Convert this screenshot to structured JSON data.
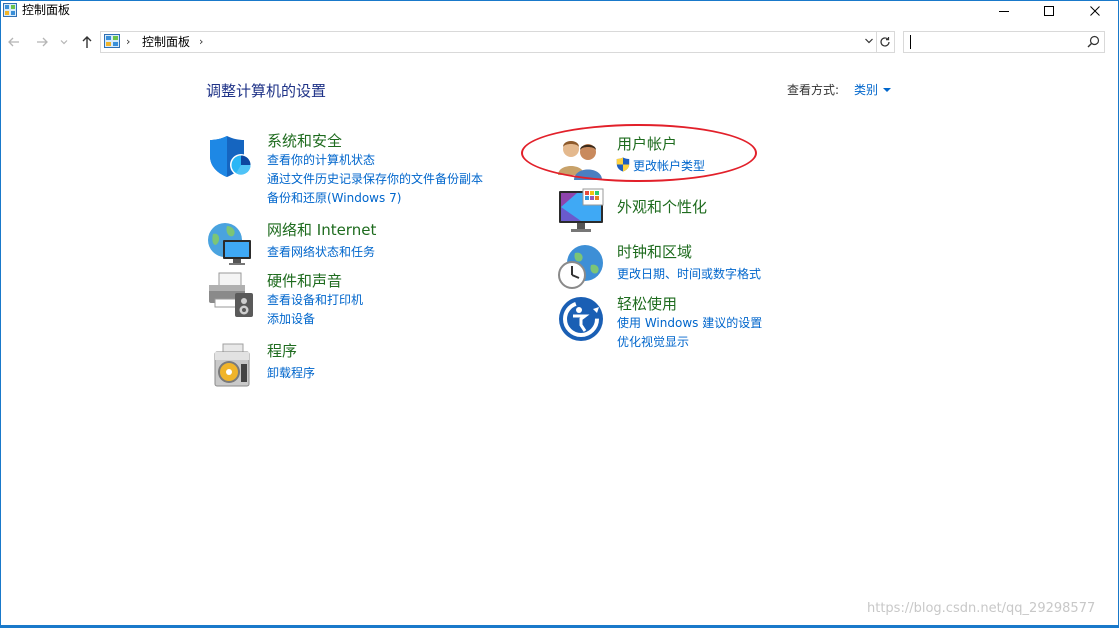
{
  "window": {
    "title": "控制面板",
    "icon": "control-panel-icon",
    "controls": [
      "minimize-icon",
      "maximize-icon",
      "close-icon"
    ]
  },
  "navigation": {
    "back_icon": "back-arrow-icon",
    "forward_icon": "forward-arrow-icon",
    "recent_icon": "chevron-down-icon",
    "up_icon": "up-arrow-icon",
    "address_path": [
      "控制面板"
    ],
    "search_value": ""
  },
  "main": {
    "heading": "调整计算机的设置",
    "view_by_label": "查看方式:",
    "view_by_value": "类别"
  },
  "categories": {
    "system_security": {
      "title": "系统和安全",
      "links": [
        "查看你的计算机状态",
        "通过文件历史记录保存你的文件备份副本",
        "备份和还原(Windows 7)"
      ]
    },
    "network": {
      "title": "网络和 Internet",
      "links": [
        "查看网络状态和任务"
      ]
    },
    "hardware": {
      "title": "硬件和声音",
      "links": [
        "查看设备和打印机",
        "添加设备"
      ]
    },
    "programs": {
      "title": "程序",
      "links": [
        "卸载程序"
      ]
    },
    "user_accounts": {
      "title": "用户帐户",
      "links": [
        "更改帐户类型"
      ]
    },
    "appearance": {
      "title": "外观和个性化",
      "links": []
    },
    "clock_region": {
      "title": "时钟和区域",
      "links": [
        "更改日期、时间或数字格式"
      ]
    },
    "ease_access": {
      "title": "轻松使用",
      "links": [
        "使用 Windows 建议的设置",
        "优化视觉显示"
      ]
    }
  },
  "watermark": "https://blog.csdn.net/qq_29298577",
  "colors": {
    "accent": "#1979ca",
    "link": "#0066cc",
    "category_title": "#1e6b1e",
    "heading": "#1e3287",
    "annotation": "#e2202a"
  }
}
